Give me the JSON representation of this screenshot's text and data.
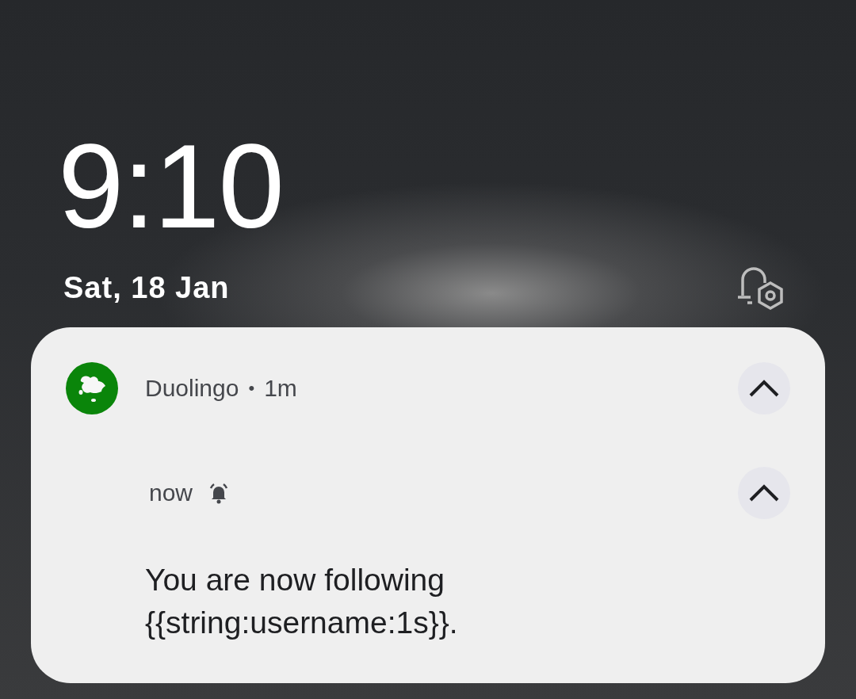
{
  "lock_screen": {
    "time": "9:10",
    "date": "Sat, 18 Jan"
  },
  "notification": {
    "app_name": "Duolingo",
    "separator": "•",
    "age": "1m",
    "expanded": true,
    "message": {
      "time": "now",
      "expanded": true,
      "text": "You are now following {{string:username:1s}}."
    }
  }
}
